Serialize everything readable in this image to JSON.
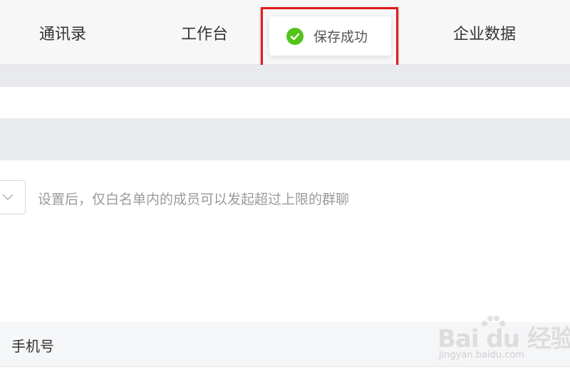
{
  "nav": {
    "contacts": "通讯录",
    "workbench": "工作台",
    "enterprise_data": "企业数据"
  },
  "toast": {
    "icon": "success-check-icon",
    "text": "保存成功",
    "icon_color": "#52c41a"
  },
  "highlight": {
    "color": "#e01b1b"
  },
  "settings": {
    "select_icon": "chevron-down-icon",
    "hint": "设置后，仅白名单内的成员可以发起超过上限的群聊"
  },
  "table": {
    "columns": [
      "手机号"
    ]
  },
  "watermark": {
    "logo": "Bai du 经验",
    "url": "jingyan.baidu.com"
  }
}
